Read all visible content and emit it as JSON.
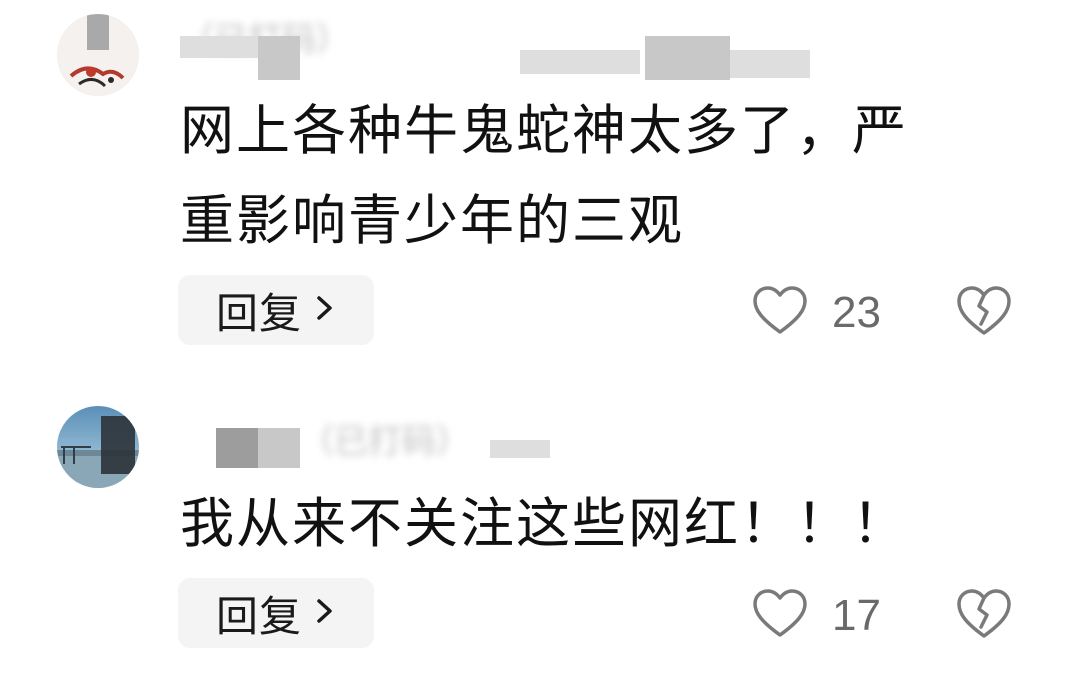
{
  "comments": [
    {
      "avatar": {
        "icon": "avatar-illustration"
      },
      "author_meta": "（已打码）",
      "text_line_1": "网上各种牛鬼蛇神太多了，严",
      "text_line_2": "重影响青少年的三观",
      "reply_label": "回复",
      "reply_icon": "chevron-right-icon",
      "like_icon": "heart-outline-icon",
      "like_count": "23",
      "dislike_icon": "broken-heart-icon"
    },
    {
      "avatar": {
        "icon": "avatar-seaside-photo"
      },
      "author_meta": "（已打码）",
      "text_line_1": "我从来不关注这些网红！！！",
      "reply_label": "回复",
      "reply_icon": "chevron-right-icon",
      "like_icon": "heart-outline-icon",
      "like_count": "17",
      "dislike_icon": "broken-heart-icon"
    }
  ],
  "colors": {
    "text": "#111111",
    "meta": "#8a8a8a",
    "count": "#6a6a6a",
    "reply_bg": "#f4f4f4",
    "icon_stroke": "#7a7a7a"
  }
}
